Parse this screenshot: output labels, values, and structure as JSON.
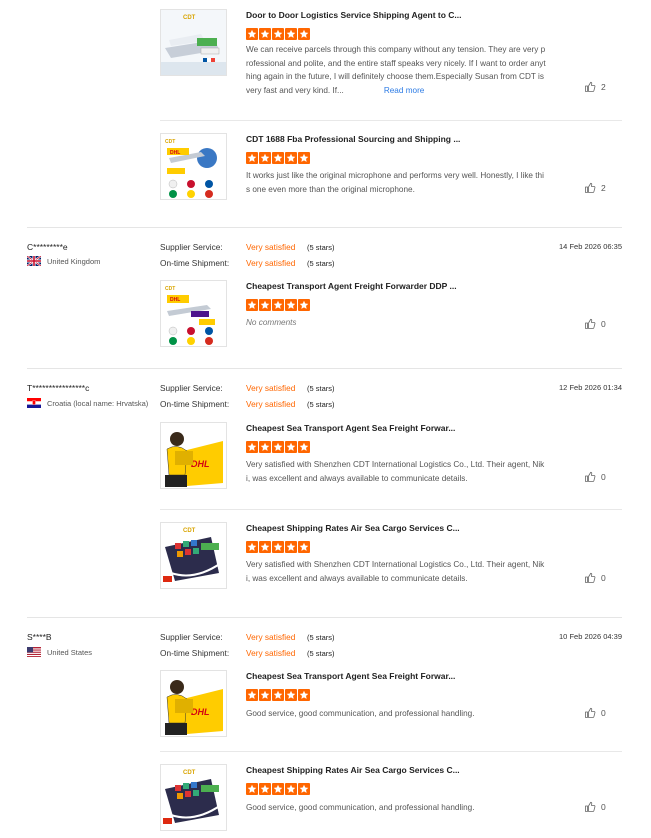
{
  "reviews": [
    {
      "products": [
        {
          "title": "Door to Door Logistics Service Shipping Agent to C...",
          "rating": 5,
          "comment": "We can receive parcels through this company without any tension. They are very professional and polite, and the entire staff speaks very nicely. If I want to order anything again in the future, I will definitely choose them.Especially Susan from CDT is very fast and very kind. If...",
          "read_more": "Read more",
          "likes": "2",
          "image_icon": "ship-logistics-icon"
        },
        {
          "title": "CDT 1688 Fba Professional Sourcing and Shipping ...",
          "rating": 5,
          "comment": "It works just like the original microphone and performs very well. Honestly, I like this one even more than the original microphone.",
          "likes": "2",
          "image_icon": "dhl-plane-icon"
        }
      ]
    },
    {
      "user": "C*********e",
      "country": "United Kingdom",
      "flag_icon": "uk-flag-icon",
      "date": "14 Feb 2026 06:35",
      "supplier_service_label": "Supplier Service:",
      "supplier_service_value": "Very satisfied",
      "supplier_service_stars": "(5 stars)",
      "shipment_label": "On-time Shipment:",
      "shipment_value": "Very satisfied",
      "shipment_stars": "(5 stars)",
      "products": [
        {
          "title": "Cheapest Transport Agent Freight Forwarder DDP ...",
          "rating": 5,
          "comment": "No comments",
          "likes": "0",
          "image_icon": "plane-trucks-icon"
        }
      ]
    },
    {
      "user": "T****************c",
      "country": "Croatia (local name: Hrvatska)",
      "flag_icon": "croatia-flag-icon",
      "date": "12 Feb 2026 01:34",
      "supplier_service_label": "Supplier Service:",
      "supplier_service_value": "Very satisfied",
      "supplier_service_stars": "(5 stars)",
      "shipment_label": "On-time Shipment:",
      "shipment_value": "Very satisfied",
      "shipment_stars": "(5 stars)",
      "products": [
        {
          "title": "Cheapest Sea Transport Agent Sea Freight Forwar...",
          "rating": 5,
          "comment": "Very satisfied with Shenzhen CDT International Logistics Co., Ltd. Their agent, Niki, was excellent and always available to communicate details.",
          "likes": "0",
          "image_icon": "dhl-courier-icon"
        },
        {
          "title": "Cheapest Shipping Rates Air Sea Cargo Services C...",
          "rating": 5,
          "comment": "Very satisfied with Shenzhen CDT International Logistics Co., Ltd. Their agent, Niki, was excellent and always available to communicate details.",
          "likes": "0",
          "image_icon": "cargo-ship-icon"
        }
      ]
    },
    {
      "user": "S****B",
      "country": "United States",
      "flag_icon": "us-flag-icon",
      "date": "10 Feb 2026 04:39",
      "supplier_service_label": "Supplier Service:",
      "supplier_service_value": "Very satisfied",
      "supplier_service_stars": "(5 stars)",
      "shipment_label": "On-time Shipment:",
      "shipment_value": "Very satisfied",
      "shipment_stars": "(5 stars)",
      "products": [
        {
          "title": "Cheapest Sea Transport Agent Sea Freight Forwar...",
          "rating": 5,
          "comment": "Good service, good communication, and professional handling.",
          "likes": "0",
          "image_icon": "dhl-courier-icon"
        },
        {
          "title": "Cheapest Shipping Rates Air Sea Cargo Services C...",
          "rating": 5,
          "comment": "Good service, good communication, and professional handling.",
          "likes": "0",
          "image_icon": "cargo-ship-icon"
        }
      ]
    }
  ],
  "colors": {
    "accent": "#ff6600",
    "star": "#ff6600",
    "link": "#2c7be5"
  }
}
